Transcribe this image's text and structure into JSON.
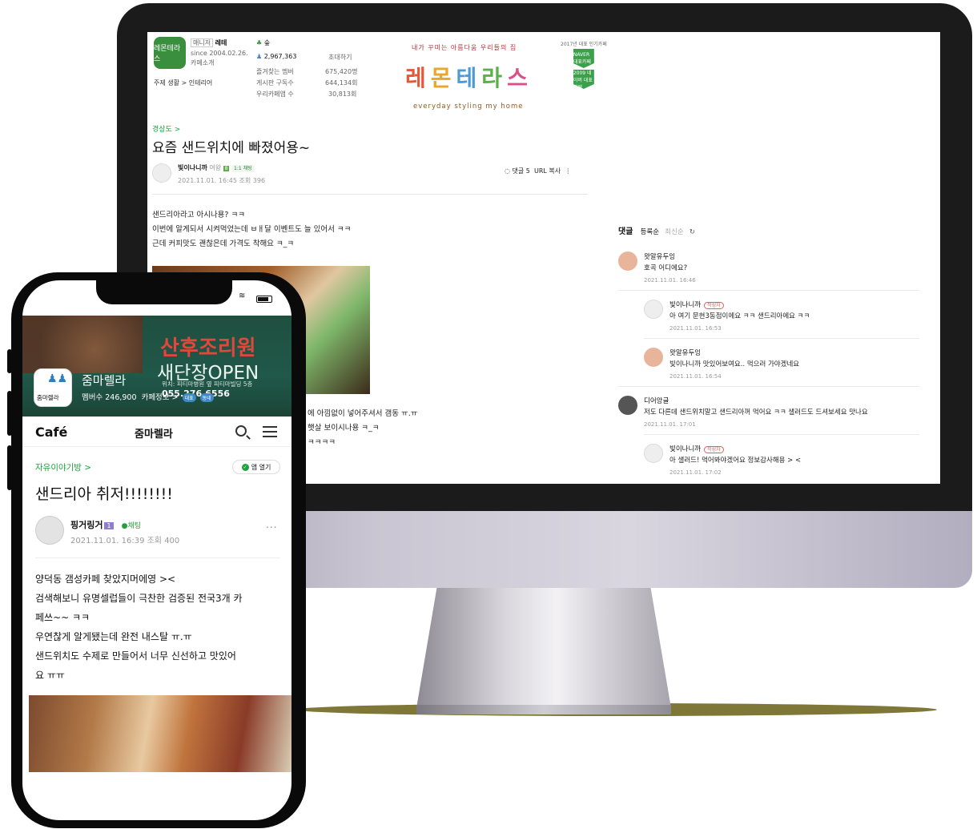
{
  "desktop": {
    "cafe": {
      "logo_text": "레몬테라스",
      "manager_tag": "매니저",
      "manager_name": "레테",
      "since": "since 2004.02.26.",
      "intro_link": "카페소개",
      "topic": "주제 생활 > 인테리어",
      "grade": "숲",
      "members": "2,967,363",
      "invite": "초대하기",
      "stats": [
        {
          "label": "즐겨찾는 멤버",
          "value": "675,420명"
        },
        {
          "label": "게시판 구독수",
          "value": "644,134회"
        },
        {
          "label": "우리카페앱 수",
          "value": "30,813회"
        }
      ]
    },
    "banner": {
      "top_text": "내가 꾸미는 아름다움  우리들의 집",
      "title_chars": [
        "레",
        "몬",
        "테",
        "라",
        "스"
      ],
      "subtitle": "everyday styling my home",
      "award_year": "2017년 대표 인기카페",
      "badge1": "NAVER 대표카페",
      "badge2": "2009 네이버 대표카페"
    },
    "post": {
      "board": "경상도 >",
      "title": "요즘 샌드위치에 빠졌어용~",
      "author": "빛이나니까",
      "author_grade": "여왕",
      "chat_label": "1:1 채팅",
      "date": "2021.11.01. 16:45",
      "views": "조회 396",
      "comment_count": "댓글 5",
      "url_copy": "URL 복사",
      "body": [
        "샌드리아라고 아시나용? ㅋㅋ",
        "이번에 알게되서 시켜먹었는데 ㅂㅐ달 이벤트도 늘 있어서 ㅋㅋ",
        "근데 커피맛도 괜찮은데 가격도 착해요 ㅋ_ㅋ"
      ],
      "body_partial": [
        "에 아낌없이 넣어주셔서 갬동 ㅠ.ㅠ",
        "햇살 보이시나용 ㅋ_ㅋ",
        "ㅋㅋㅋㅋ"
      ]
    },
    "comments": {
      "header": "댓글",
      "sort_registered": "등록순",
      "sort_latest": "최신순",
      "refresh_glyph": "↻",
      "writer_badge": "작성자",
      "items": [
        {
          "name": "왓알유두잉",
          "text": "호곡 어디에요?",
          "date": "2021.11.01. 16:46"
        },
        {
          "name": "빛이나니까",
          "text": "아 여기 문현3동점이에요 ㅋㅋ 샌드리아에요 ㅋㅋ",
          "date": "2021.11.01. 16:53"
        },
        {
          "name": "왓알유두잉",
          "text": "빛이나니까 맛있어보여요.. 먹으러 가야겠네요",
          "date": "2021.11.01. 16:54"
        },
        {
          "name": "디어앙글",
          "text": "저도 다른데 샌드위치말고 샌드리아꺼 먹어요 ㅋㅋ 샐러드도 드셔보세요 맛나요",
          "date": "2021.11.01. 17:01"
        },
        {
          "name": "빛이나니까",
          "text": "아 샐러드! 먹어봐야겠어요 정보감사해용 > <",
          "date": "2021.11.01. 17:02"
        }
      ]
    },
    "colors": {
      "accent": "#1fa13c",
      "monitor": "#1b1b1b"
    }
  },
  "mobile": {
    "hero": {
      "line1": "산후조리원",
      "line2": "새단장OPEN",
      "line3": "위치: 피티마병원 옆 피티마빌딩 5층",
      "phone": "055.276.6556",
      "cafe_icon_label": "줌마렐라",
      "cafe_name": "줌마렐라",
      "members": "멤버수 246,900",
      "info": "카페정보 >",
      "badge1": "대표",
      "badge2": "동네"
    },
    "topbar": {
      "brand": "Café",
      "title": "줌마렐라"
    },
    "post": {
      "board": "자유이야기방 >",
      "open_app": "앱 열기",
      "title": "샌드리아 취저!!!!!!!!",
      "author": "핑거링거",
      "level": "1",
      "chat": "채팅",
      "date": "2021.11.01. 16:39 조회 400",
      "more": "...",
      "body": [
        "양덕동 갬성카페 찾았지머에영 ><",
        "검색해보니 유명셀럽들이 극찬한 검증된 전국3개 카",
        "페쓰~~ ㅋㅋ",
        "우연찮게 알게됐는데 완전 내스탈 ㅠ.ㅠ",
        "샌드위치도 수제로 만들어서 너무 신선하고 맛있어",
        "요 ㅠㅠ"
      ]
    }
  }
}
